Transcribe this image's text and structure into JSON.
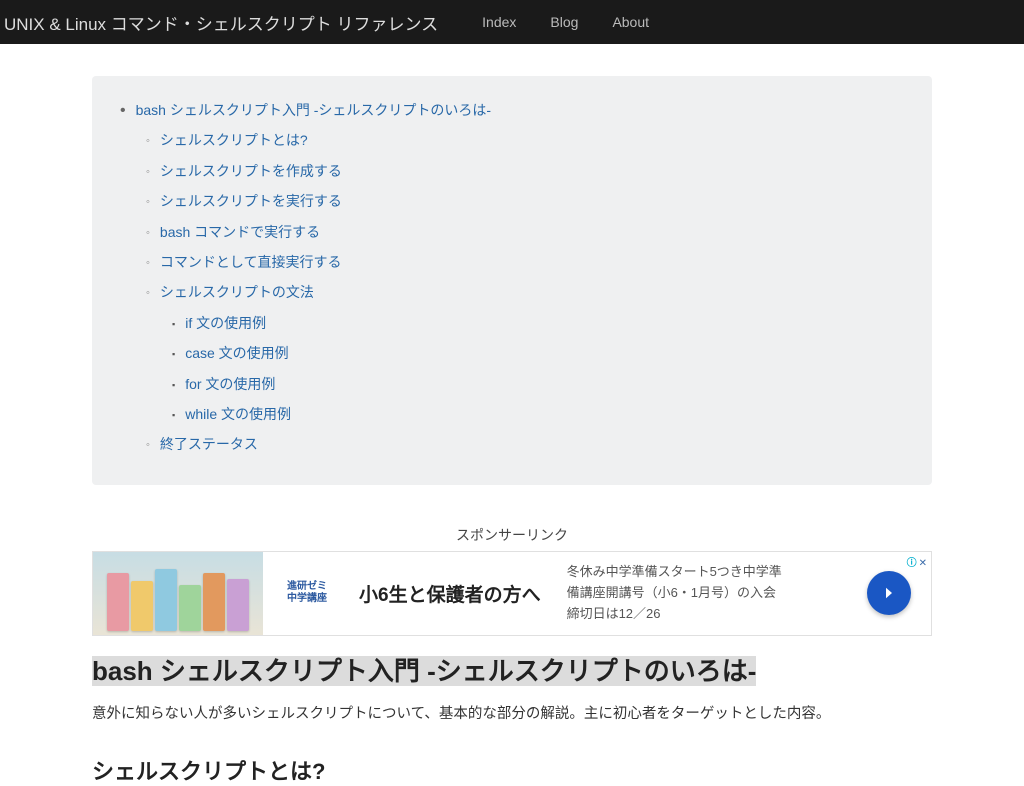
{
  "navbar": {
    "brand": "UNIX & Linux コマンド・シェルスクリプト リファレンス",
    "links": [
      "Index",
      "Blog",
      "About"
    ]
  },
  "toc": {
    "root": "bash シェルスクリプト入門 -シェルスクリプトのいろは-",
    "items": [
      "シェルスクリプトとは?",
      "シェルスクリプトを作成する",
      "シェルスクリプトを実行する",
      "bash コマンドで実行する",
      "コマンドとして直接実行する",
      "シェルスクリプトの文法"
    ],
    "sub": [
      "if 文の使用例",
      "case 文の使用例",
      "for 文の使用例",
      "while 文の使用例"
    ],
    "last": "終了ステータス"
  },
  "sponsor": {
    "label": "スポンサーリンク",
    "logo_l1": "進研ゼミ",
    "logo_l2": "中学講座",
    "headline": "小6生と保護者の方へ",
    "sub": "冬休み中学準備スタート5つき中学準備講座開講号（小6・1月号）の入会締切日は12／26"
  },
  "article": {
    "h1": "bash シェルスクリプト入門 -シェルスクリプトのいろは-",
    "lead": "意外に知らない人が多いシェルスクリプトについて、基本的な部分の解説。主に初心者をターゲットとした内容。",
    "h2cut": "シェルスクリプトとは?"
  }
}
